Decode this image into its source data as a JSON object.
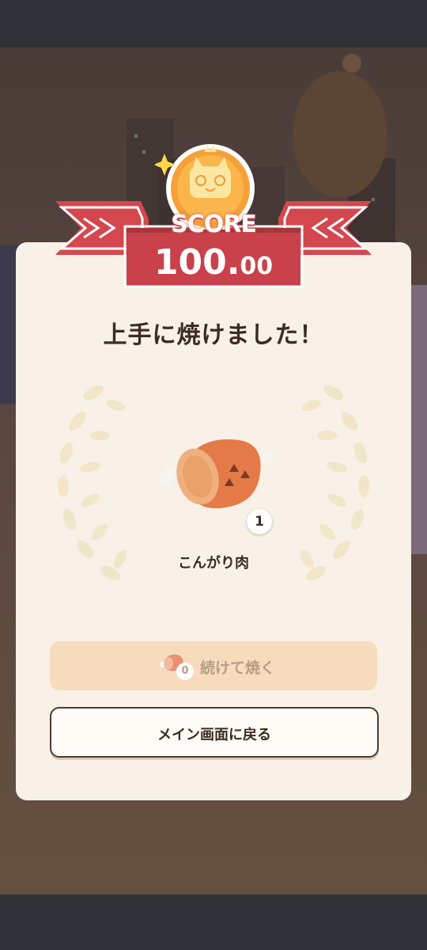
{
  "score": {
    "label": "SCORE",
    "value_int": "100.",
    "value_dec": "00"
  },
  "result": {
    "headline": "上手に焼けました！",
    "item_name": "こんがり肉",
    "item_count": "1"
  },
  "buttons": {
    "continue_label": "続けて焼く",
    "continue_count": "0",
    "back_label": "メイン画面に戻る"
  },
  "colors": {
    "card_bg": "#f9f1e7",
    "ribbon_red": "#d4474f",
    "coin_orange": "#f7a03a",
    "disabled_button": "#f6dcbd",
    "text_dark": "#3b2c22"
  }
}
